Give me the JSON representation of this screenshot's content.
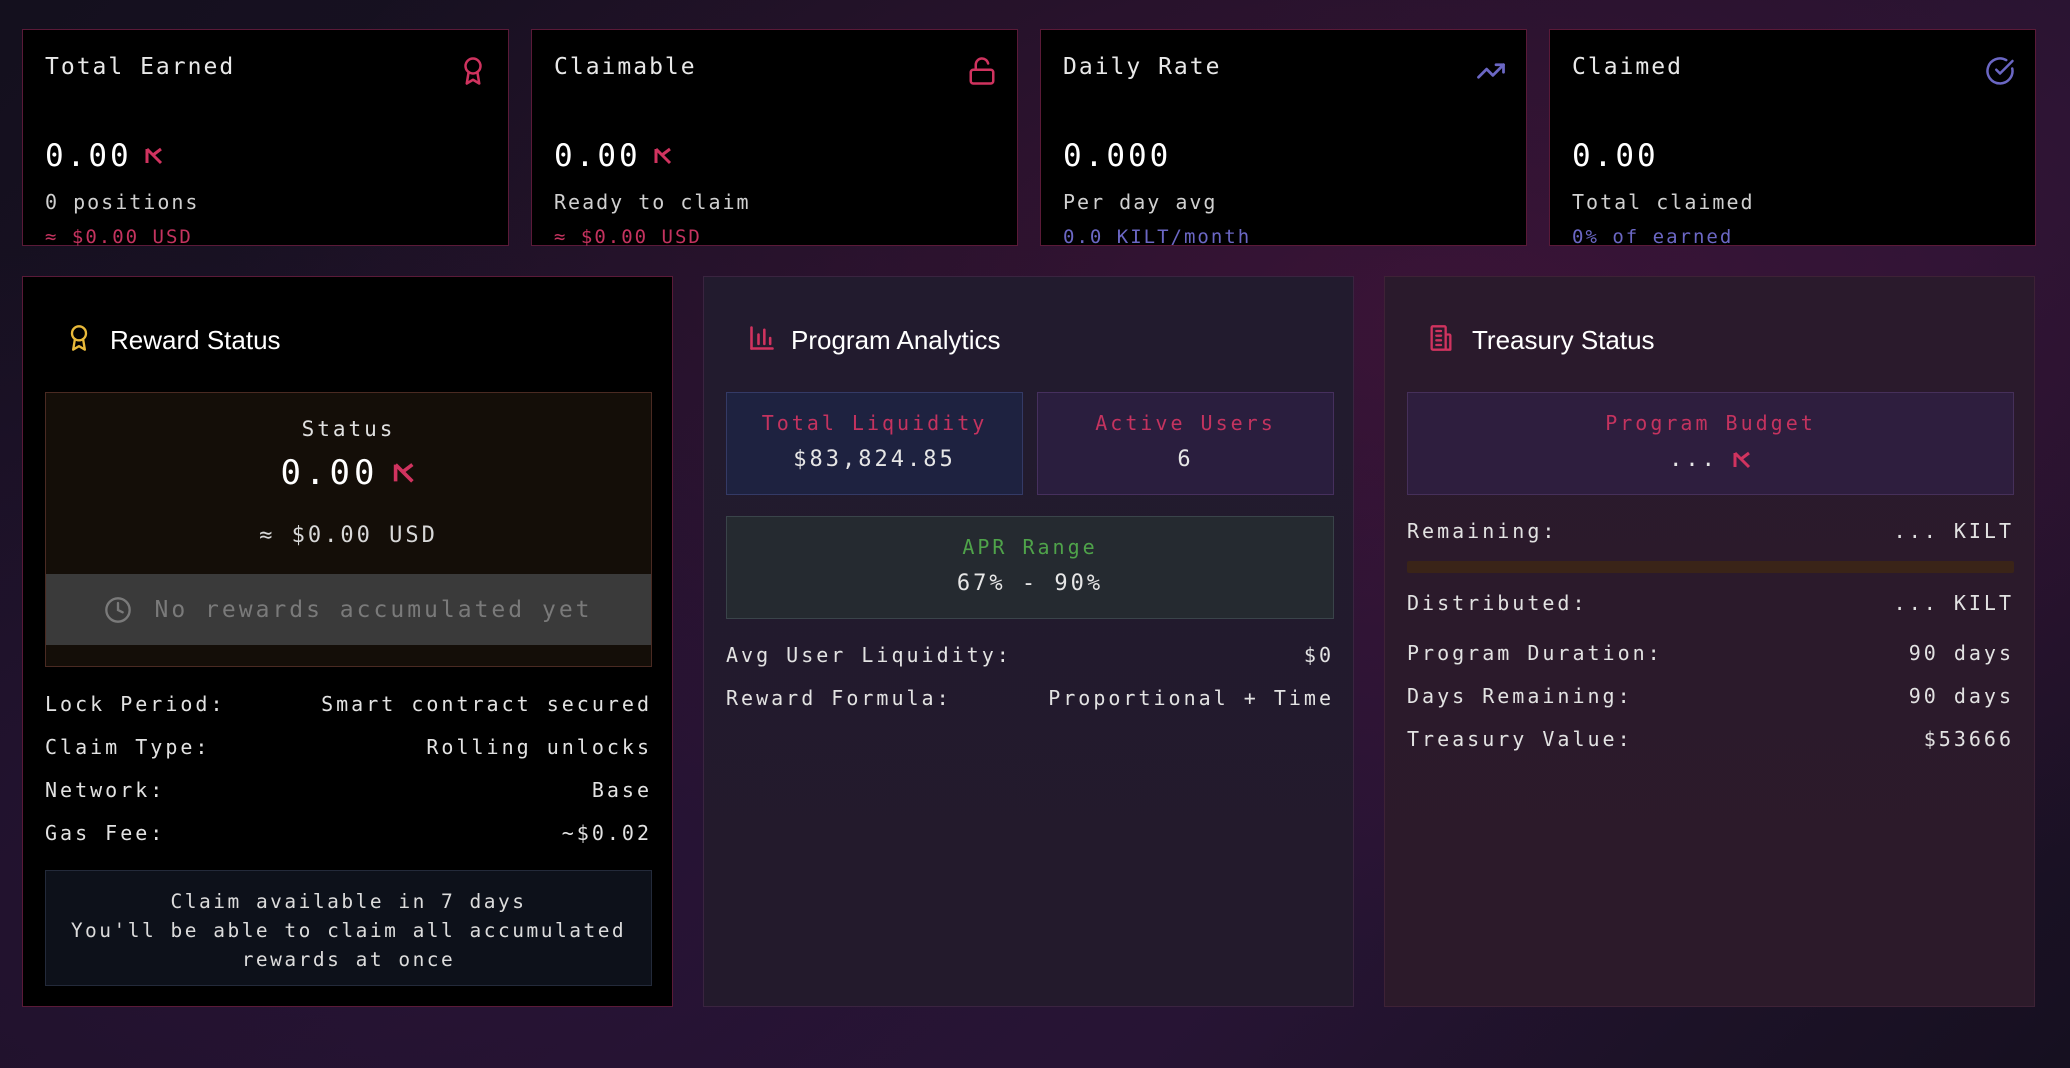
{
  "stats": [
    {
      "label": "Total Earned",
      "value": "0.00",
      "sub": "0 positions",
      "sub2": "≈ $0.00 USD",
      "icon": "award-icon",
      "show_kilt": true
    },
    {
      "label": "Claimable",
      "value": "0.00",
      "sub": "Ready to claim",
      "sub2": "≈ $0.00 USD",
      "icon": "unlock-icon",
      "show_kilt": true
    },
    {
      "label": "Daily Rate",
      "value": "0.000",
      "sub": "Per day avg",
      "sub2": "0.0 KILT/month",
      "icon": "trending-up-icon",
      "show_kilt": false
    },
    {
      "label": "Claimed",
      "value": "0.00",
      "sub": "Total claimed",
      "sub2": "0% of earned",
      "icon": "check-circle-icon",
      "show_kilt": false
    }
  ],
  "reward_status": {
    "title": "Reward Status",
    "status_label": "Status",
    "status_value": "0.00",
    "status_usd": "≈ $0.00 USD",
    "no_rewards": "No rewards accumulated yet",
    "rows": [
      {
        "k": "Lock Period:",
        "v": "Smart contract secured"
      },
      {
        "k": "Claim Type:",
        "v": "Rolling unlocks"
      },
      {
        "k": "Network:",
        "v": "Base"
      },
      {
        "k": "Gas Fee:",
        "v": "~$0.02"
      }
    ],
    "claim_line1": "Claim available in 7 days",
    "claim_line2": "You'll be able to claim all accumulated",
    "claim_line3": "rewards at once"
  },
  "analytics": {
    "title": "Program Analytics",
    "total_liquidity_label": "Total Liquidity",
    "total_liquidity": "$83,824.85",
    "active_users_label": "Active Users",
    "active_users": "6",
    "apr_label": "APR Range",
    "apr": "67% - 90%",
    "rows": [
      {
        "k": "Avg User Liquidity:",
        "v": "$0"
      },
      {
        "k": "Reward Formula:",
        "v": "Proportional + Time"
      }
    ]
  },
  "treasury": {
    "title": "Treasury Status",
    "budget_label": "Program Budget",
    "budget_value": "...",
    "remaining_label": "Remaining:",
    "remaining_value": "... KILT",
    "remaining_progress": 0,
    "rows": [
      {
        "k": "Distributed:",
        "v": "... KILT"
      },
      {
        "k": "Program Duration:",
        "v": "90 days"
      },
      {
        "k": "Days Remaining:",
        "v": "90 days"
      },
      {
        "k": "Treasury Value:",
        "v": "$53666"
      }
    ]
  },
  "colors": {
    "accent_pink": "#c4335f",
    "accent_purple": "#6b67c4",
    "gold": "#e8b93a",
    "green": "#4fa34a"
  }
}
